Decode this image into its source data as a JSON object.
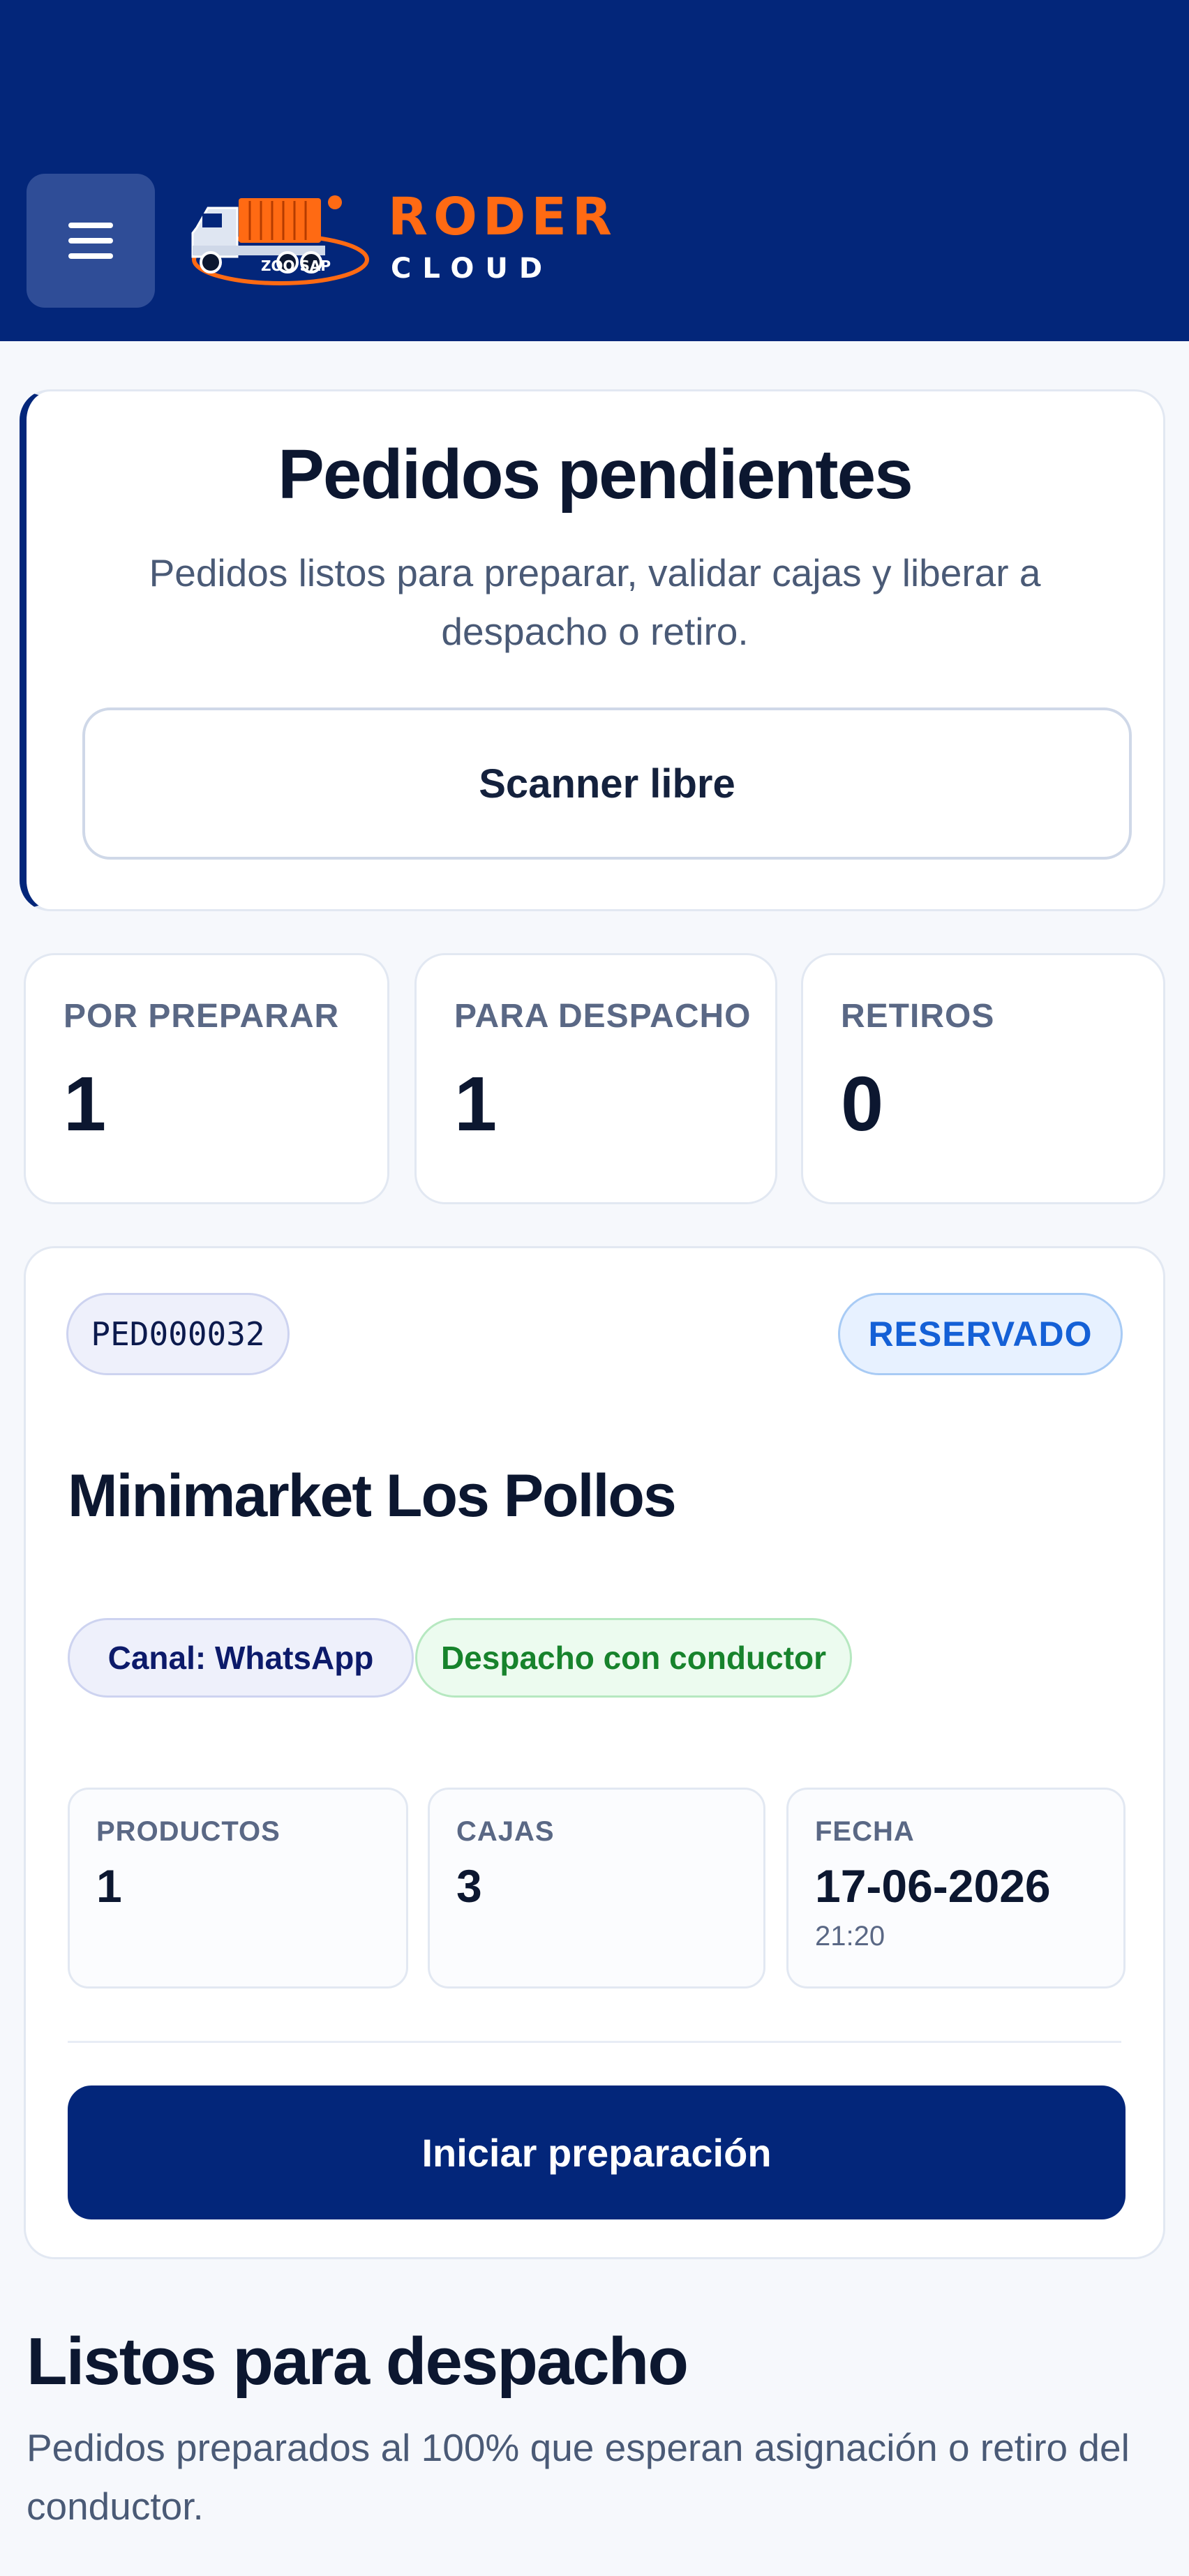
{
  "header": {
    "brand_name": "RODER",
    "brand_sub": "CLOUD",
    "logo_truck_text": "ZOO SAP",
    "colors": {
      "bar": "#03267a",
      "brand_orange": "#ff6a13"
    },
    "menu_icon": "hamburger-menu-icon"
  },
  "hero": {
    "title": "Pedidos pendientes",
    "subtitle": "Pedidos listos para preparar, validar cajas y liberar a despacho o retiro.",
    "scanner_label": "Scanner libre"
  },
  "stats": [
    {
      "label": "POR PREPARAR",
      "value": "1"
    },
    {
      "label": "PARA DESPACHO",
      "value": "1"
    },
    {
      "label": "RETIROS",
      "value": "0"
    }
  ],
  "order": {
    "id": "PED000032",
    "status": "RESERVADO",
    "customer": "Minimarket Los Pollos",
    "channel": "Canal: WhatsApp",
    "dispatch": "Despacho con conductor",
    "meta": [
      {
        "label": "PRODUCTOS",
        "value": "1"
      },
      {
        "label": "CAJAS",
        "value": "3"
      },
      {
        "label": "FECHA",
        "value": "17-06-2026",
        "time": "21:20"
      }
    ],
    "action_label": "Iniciar preparación"
  },
  "ready_section": {
    "title": "Listos para despacho",
    "subtitle": "Pedidos preparados al 100% que esperan asignación o retiro del conductor."
  }
}
